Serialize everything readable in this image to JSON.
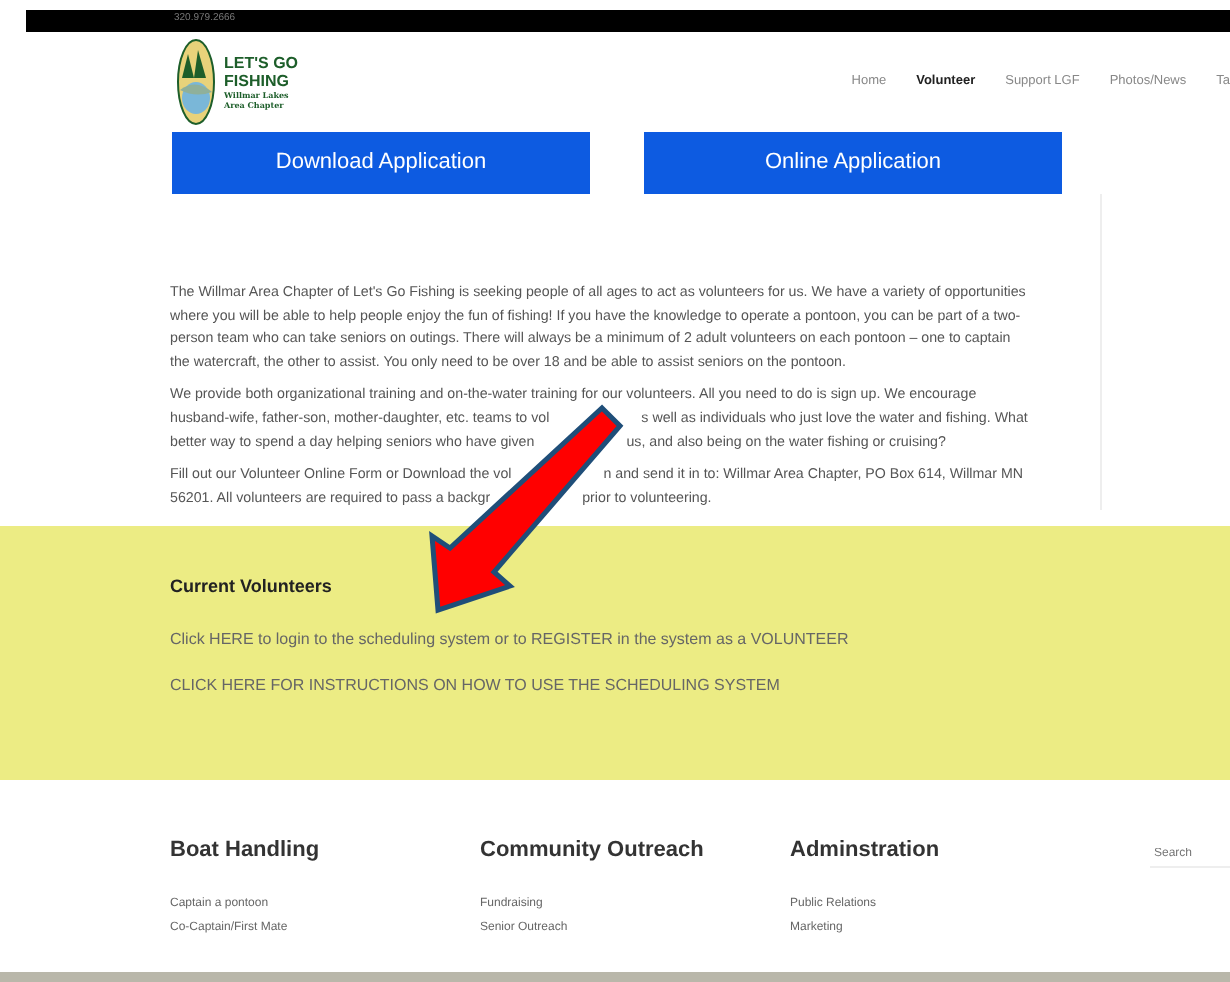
{
  "top_bar": {
    "phone": "320.979.2666"
  },
  "logo": {
    "title_lines": [
      "LET'S GO",
      "FISHING"
    ],
    "subtitle_lines": [
      "Willmar Lakes",
      "Area Chapter"
    ]
  },
  "nav": [
    {
      "label": "Home",
      "selected": false
    },
    {
      "label": "Volunteer",
      "selected": true
    },
    {
      "label": "Support LGF",
      "selected": false
    },
    {
      "label": "Photos/News",
      "selected": false
    },
    {
      "label": "Ta",
      "selected": false
    }
  ],
  "buttons": [
    "Download Application",
    "Online Application"
  ],
  "paragraphs": [
    [
      [
        "The Willmar Area Chapter of Let's Go Fishing is seeking people of all ages to act as volunteers for us. We have a variety of opportunities"
      ],
      [
        "where you will be able to help people enjoy the fun of fishing! If you have the knowledge to operate a pontoon, you can be part of a two-"
      ],
      [
        "person team who can take seniors on outings. There will always be a minimum of 2 adult volunteers on each pontoon – one to captain"
      ],
      [
        "the watercraft, the other to assist.  You only need to be over 18 and be able to assist seniors on the pontoon."
      ]
    ],
    [
      [
        "We provide both organizational training and on-the-water training for our volunteers.  All you need to do is sign up.  We encourage"
      ],
      [
        "husband-wife, father-son, mother-daughter, etc. teams to vol",
        "s well as individuals who just love the water and fishing.  What"
      ],
      [
        "better way to spend a day helping seniors who have given",
        "us, and also being on the water fishing or cruising?"
      ]
    ],
    [
      [
        "Fill out our Volunteer Online Form or Download the vol",
        "n and send it in to: Willmar Area Chapter, PO Box 614, Willmar MN"
      ],
      [
        "56201. All volunteers are required to pass a backgr",
        "prior to volunteering."
      ]
    ]
  ],
  "volunteers": {
    "heading": "Current Volunteers",
    "links": [
      "Click HERE to login to the scheduling system or to REGISTER in the system as a VOLUNTEER",
      "CLICK HERE FOR INSTRUCTIONS ON HOW TO USE THE SCHEDULING SYSTEM"
    ]
  },
  "categories": [
    {
      "heading": "Boat Handling",
      "items": [
        "Captain a pontoon",
        "Co-Captain/First Mate"
      ]
    },
    {
      "heading": "Community Outreach",
      "items": [
        "Fundraising",
        "Senior Outreach"
      ]
    },
    {
      "heading": "Adminstration",
      "items": [
        "Public Relations",
        "Marketing"
      ]
    }
  ],
  "search": {
    "placeholder": "Search"
  }
}
